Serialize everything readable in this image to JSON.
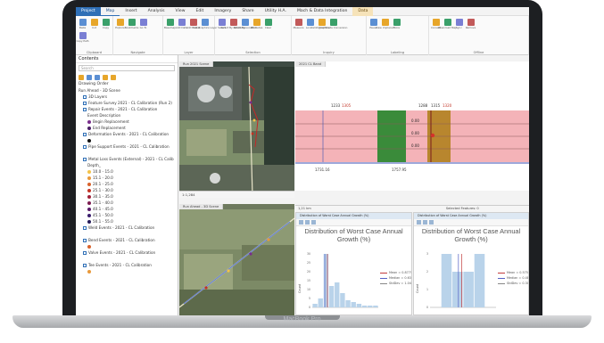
{
  "device": {
    "label": "MacBook Pro"
  },
  "ribbon": {
    "tabs": [
      {
        "label": "Project",
        "kind": "project"
      },
      {
        "label": "Map",
        "kind": "active"
      },
      {
        "label": "Insert",
        "kind": "normal"
      },
      {
        "label": "Analysis",
        "kind": "normal"
      },
      {
        "label": "View",
        "kind": "normal"
      },
      {
        "label": "Edit",
        "kind": "normal"
      },
      {
        "label": "Imagery",
        "kind": "normal"
      },
      {
        "label": "Share",
        "kind": "normal"
      },
      {
        "label": "Utility H.A.",
        "kind": "normal"
      },
      {
        "label": "Mach & Data Integration",
        "kind": "normal"
      },
      {
        "label": "Data",
        "kind": "ctx"
      }
    ],
    "groups": [
      {
        "label": "Clipboard",
        "buttons": [
          "Paste",
          "Cut",
          "Copy",
          "Copy Path"
        ]
      },
      {
        "label": "Navigate",
        "buttons": [
          "Explore",
          "Bookmarks",
          "Go To"
        ]
      },
      {
        "label": "Layer",
        "buttons": [
          "Basemap",
          "Add Data",
          "Add Preset",
          "Add Graphics Layer"
        ]
      },
      {
        "label": "Selection",
        "buttons": [
          "Select",
          "Select By Attributes",
          "Select By Location",
          "Attributes",
          "Clear"
        ]
      },
      {
        "label": "Inquiry",
        "buttons": [
          "Measure",
          "Locate",
          "Infographics",
          "Coordinate Conversion"
        ]
      },
      {
        "label": "Labeling",
        "buttons": [
          "Pause",
          "View Unplaced",
          "More"
        ]
      },
      {
        "label": "Offline",
        "buttons": [
          "Convert",
          "Download Map",
          "Sync",
          "Remove"
        ]
      }
    ]
  },
  "contents": {
    "title": "Contents",
    "search_placeholder": "Search",
    "drawing_order": "Drawing Order",
    "items": [
      {
        "label": "Run Ahead - 3D Scene",
        "indent": 0,
        "sym": ""
      },
      {
        "label": "3D Layers",
        "indent": 1,
        "sym": ""
      },
      {
        "label": "Feature Survey 2021 - CL Calibration (Run 2)",
        "indent": 1,
        "sym": ""
      },
      {
        "label": "Repair Events - 2021 - CL Calibration",
        "indent": 1,
        "sym": ""
      },
      {
        "label": "Event Description",
        "indent": 2,
        "sym": ""
      },
      {
        "label": "Begin Replacement",
        "indent": 2,
        "sym": "#7a2d8c"
      },
      {
        "label": "End Replacement",
        "indent": 2,
        "sym": "#4a1e66"
      },
      {
        "label": "Deformation Events - 2021 - CL Calibration",
        "indent": 1,
        "sym": ""
      },
      {
        "label": "",
        "indent": 2,
        "sym": "#111111"
      },
      {
        "label": "Pipe Support Events - 2021 - CL Calibration",
        "indent": 1,
        "sym": ""
      },
      {
        "label": "",
        "indent": 2,
        "sym": ""
      },
      {
        "label": "Metal Loss Events (External) - 2021 - CL Calib",
        "indent": 1,
        "sym": ""
      },
      {
        "label": "Depth_",
        "indent": 2,
        "sym": ""
      },
      {
        "label": "10.0 - 15.0",
        "indent": 2,
        "sym": "#f3c34a"
      },
      {
        "label": "15.1 - 20.0",
        "indent": 2,
        "sym": "#e9993b"
      },
      {
        "label": "20.1 - 25.0",
        "indent": 2,
        "sym": "#d9622c"
      },
      {
        "label": "25.1 - 30.0",
        "indent": 2,
        "sym": "#c23325"
      },
      {
        "label": "30.1 - 35.0",
        "indent": 2,
        "sym": "#a1203a"
      },
      {
        "label": "35.1 - 40.0",
        "indent": 2,
        "sym": "#7c1c50"
      },
      {
        "label": "40.1 - 45.0",
        "indent": 2,
        "sym": "#5a1a6a"
      },
      {
        "label": "45.1 - 50.0",
        "indent": 2,
        "sym": "#3a1d6e"
      },
      {
        "label": "50.1 - 55.0",
        "indent": 2,
        "sym": "#241a5a"
      },
      {
        "label": "Weld Events - 2021 - CL Calibration",
        "indent": 1,
        "sym": ""
      },
      {
        "label": "",
        "indent": 2,
        "sym": ""
      },
      {
        "label": "Bend Events - 2021 - CL Calibration",
        "indent": 1,
        "sym": ""
      },
      {
        "label": "",
        "indent": 2,
        "sym": "#d9622c"
      },
      {
        "label": "Valve Events - 2021 - CL Calibration",
        "indent": 1,
        "sym": ""
      },
      {
        "label": "",
        "indent": 2,
        "sym": ""
      },
      {
        "label": "Tee Events - 2021 - CL Calibration",
        "indent": 1,
        "sym": ""
      },
      {
        "label": "",
        "indent": 2,
        "sym": "#e9993b"
      }
    ]
  },
  "views": {
    "map1_tab": "Run 2021 Scene",
    "map1_scale": "1:1,284",
    "map2_tab": "Run Ahead - 3D Scene",
    "band_tab": "2021 CL Band",
    "band_labels_top": [
      "1233",
      "1305",
      "1288",
      "1315",
      "1320"
    ],
    "band_labels_bottom": [
      "1731.16",
      "1757.95"
    ],
    "band_values": [
      "0.00",
      "0.00",
      "0.00"
    ],
    "status_2": "1,21 km",
    "status_3": "Selected Features: 0"
  },
  "charts": [
    {
      "tab": "Distribution of Worst Case Annual Growth (%)",
      "title": "Distribution of Worst Case Annual Growth (%)",
      "legend": [
        {
          "label": "Mean = 0.8775",
          "color": "#c23b3b"
        },
        {
          "label": "Median = 0.6303",
          "color": "#5560c4"
        },
        {
          "label": "StdDev = 1.0484",
          "color": "#888888"
        }
      ],
      "yaxis": "Count"
    },
    {
      "tab": "Distribution of Worst Case Annual Growth (%)",
      "title": "Distribution of Worst Case Annual Growth (%)",
      "legend": [
        {
          "label": "Mean = 0.5755",
          "color": "#c23b3b"
        },
        {
          "label": "Median = 0.4858",
          "color": "#5560c4"
        },
        {
          "label": "StdDev = 0.3057",
          "color": "#888888"
        }
      ],
      "yaxis": "Count"
    }
  ],
  "chart_data": [
    {
      "type": "bar",
      "title": "Distribution of Worst Case Annual Growth (%)",
      "ylabel": "Count",
      "xlabel": "",
      "categories": [
        "b1",
        "b2",
        "b3",
        "b4",
        "b5",
        "b6",
        "b7",
        "b8",
        "b9",
        "b10",
        "b11",
        "b12"
      ],
      "values": [
        2,
        5,
        30,
        12,
        14,
        8,
        4,
        3,
        2,
        1,
        1,
        1
      ],
      "ylim": [
        0,
        30
      ],
      "yticks": [
        0,
        5,
        10,
        15,
        20,
        25,
        30
      ]
    },
    {
      "type": "bar",
      "title": "Distribution of Worst Case Annual Growth (%)",
      "ylabel": "Count",
      "xlabel": "",
      "categories": [
        "b1",
        "b2",
        "b3",
        "b4",
        "b5",
        "b6"
      ],
      "values": [
        0,
        3,
        2,
        2,
        3,
        0
      ],
      "ylim": [
        0,
        3
      ],
      "yticks": [
        0,
        1,
        2,
        3
      ]
    }
  ]
}
